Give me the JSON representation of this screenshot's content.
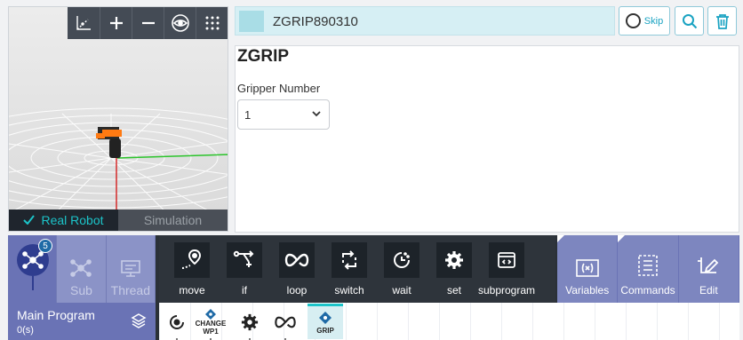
{
  "viewer": {
    "tools": [
      "axis-icon",
      "plus-icon",
      "minus-icon",
      "eye-icon",
      "grid-icon"
    ],
    "tabs": {
      "real": "Real Robot",
      "sim": "Simulation"
    }
  },
  "node": {
    "name": "ZGRIP890310",
    "skip_label": "Skip",
    "title": "ZGRIP",
    "gripper_label": "Gripper Number",
    "gripper_value": "1"
  },
  "tree": {
    "badge": "5",
    "sub": "Sub",
    "thread": "Thread",
    "main_program": "Main Program",
    "main_time": "0(s)"
  },
  "commands": [
    {
      "label": "move",
      "icon": "move-icon"
    },
    {
      "label": "if",
      "icon": "branch-icon"
    },
    {
      "label": "loop",
      "icon": "loop-icon"
    },
    {
      "label": "switch",
      "icon": "switch-icon"
    },
    {
      "label": "wait",
      "icon": "wait-icon"
    },
    {
      "label": "set",
      "icon": "gear-icon"
    },
    {
      "label": "subprogram",
      "icon": "subprogram-icon"
    }
  ],
  "tools": {
    "variables": "Variables",
    "commands": "Commands",
    "edit": "Edit"
  },
  "timeline": {
    "change_line1": "CHANGE",
    "change_line2": "WP1",
    "grip": "GRIP"
  },
  "colors": {
    "accent": "#1cc4c9",
    "toolbar": "#444b55",
    "tree": "#6a73b5"
  }
}
